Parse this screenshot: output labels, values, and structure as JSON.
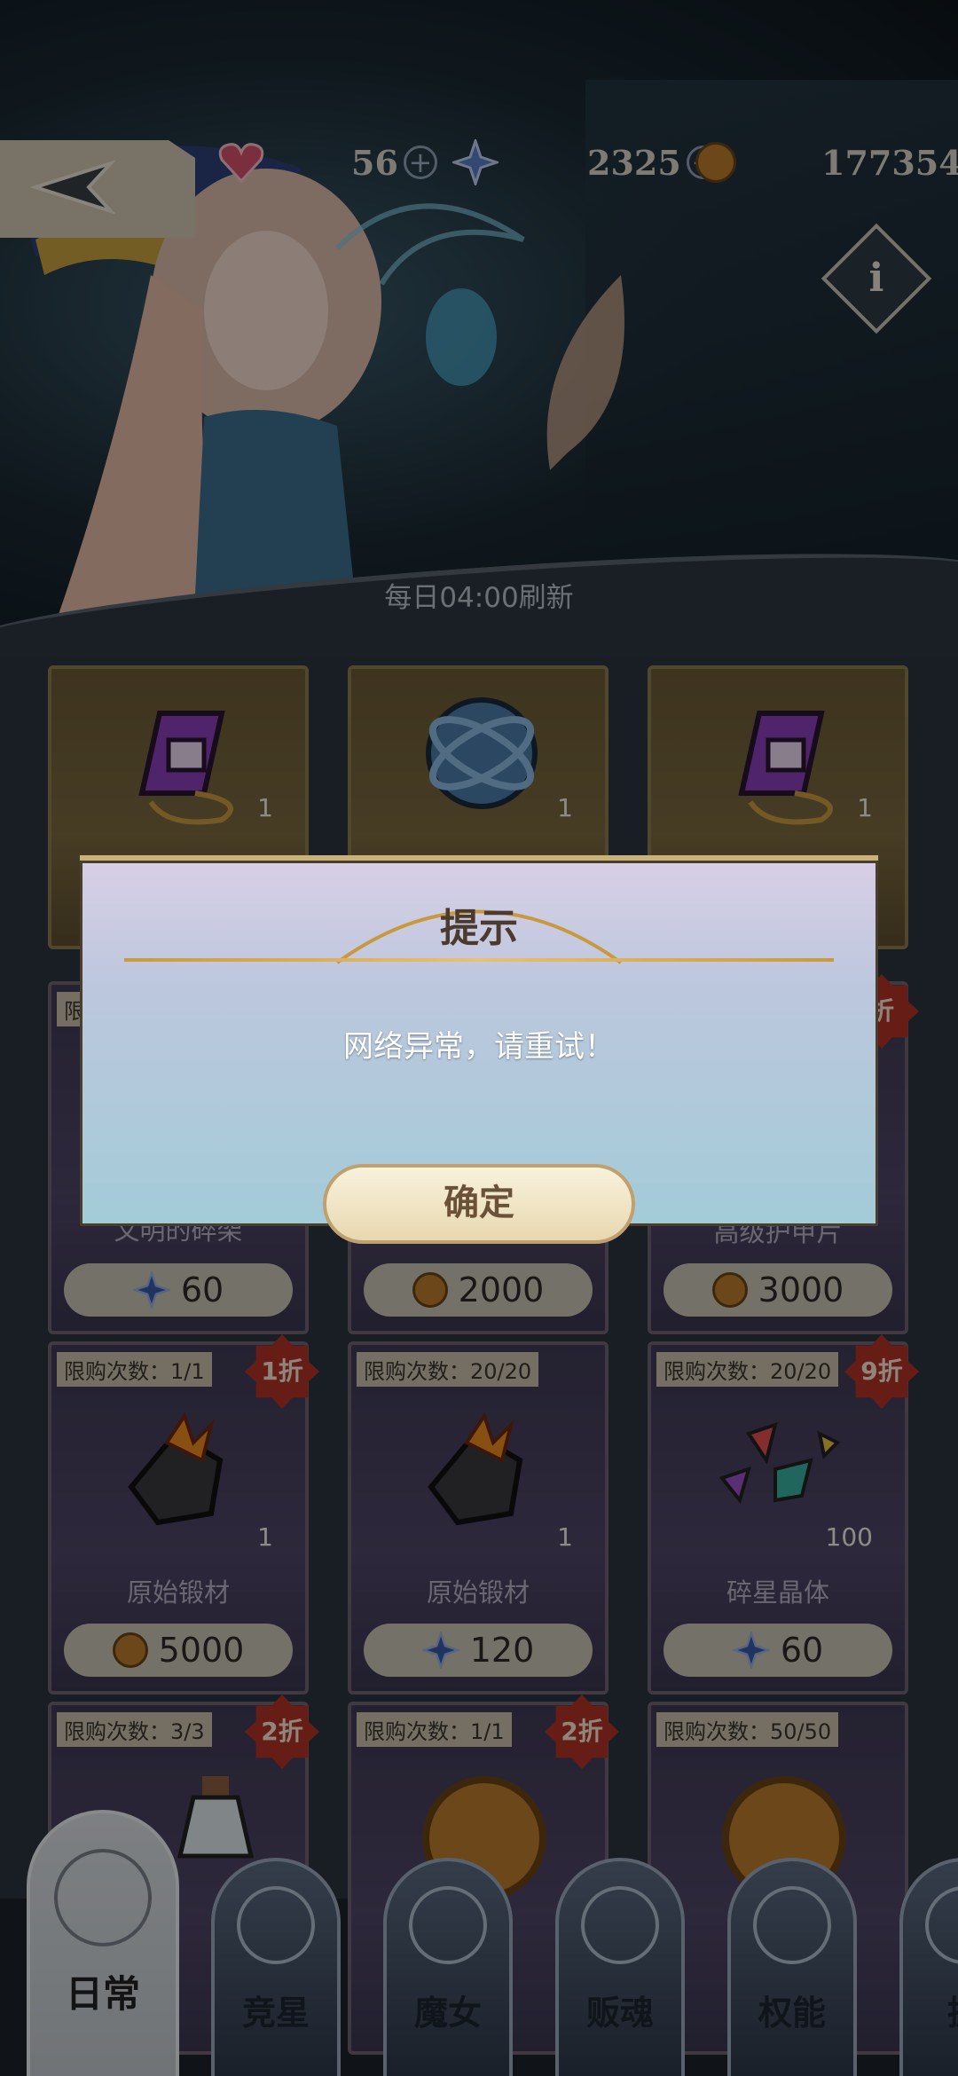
{
  "topbar": {
    "stamina": "56",
    "gems": "2325",
    "coins": "177354"
  },
  "banner": {
    "refresh_text": "每日04:00刷新"
  },
  "row1": [
    {
      "qty": "1"
    },
    {
      "qty": "1"
    },
    {
      "qty": "1"
    }
  ],
  "row2": [
    {
      "limit": "限购",
      "name": "文明的碎架",
      "price": "60",
      "currency": "gem"
    },
    {
      "name": "",
      "price": "2000",
      "currency": "coin"
    },
    {
      "name": "高级护甲片",
      "price": "3000",
      "currency": "coin"
    }
  ],
  "row3": [
    {
      "limit": "限购次数：1/1",
      "discount": "1折",
      "qty": "1",
      "name": "原始锻材",
      "price": "5000",
      "currency": "coin"
    },
    {
      "limit": "限购次数：20/20",
      "qty": "1",
      "name": "原始锻材",
      "price": "120",
      "currency": "gem"
    },
    {
      "limit": "限购次数：20/20",
      "discount": "9折",
      "qty": "100",
      "name": "碎星晶体",
      "price": "60",
      "currency": "gem"
    }
  ],
  "row4": [
    {
      "limit": "限购次数：3/3",
      "discount": "2折"
    },
    {
      "limit": "限购次数：1/1",
      "discount": "2折"
    },
    {
      "limit": "限购次数：50/50"
    }
  ],
  "row2_discount": "折",
  "dialog": {
    "title": "提示",
    "message": "网络异常，请重试！",
    "confirm": "确定"
  },
  "tabs": [
    "日常",
    "竞星",
    "魔女",
    "贩魂",
    "权能",
    "据"
  ],
  "colors": {
    "accent_gold": "#c8a050",
    "discount_red": "#b03325",
    "dialog_bg": "#bcc7dd"
  }
}
